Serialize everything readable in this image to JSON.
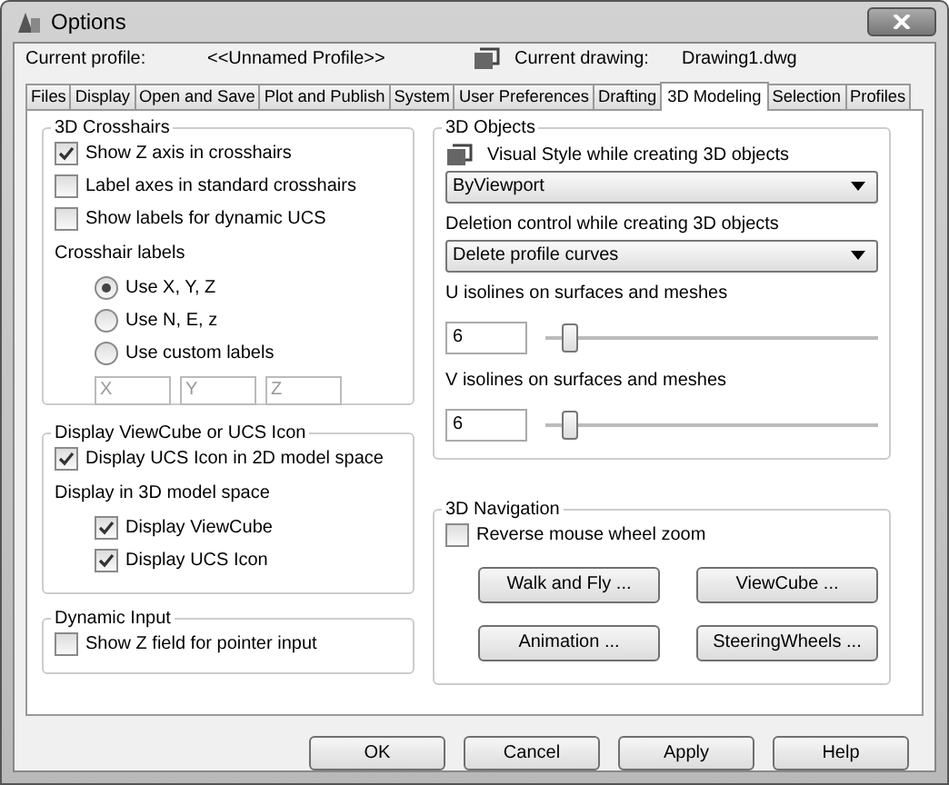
{
  "window": {
    "title": "Options"
  },
  "profile": {
    "label": "Current profile:",
    "value": "<<Unnamed Profile>>"
  },
  "drawing": {
    "label": "Current drawing:",
    "value": "Drawing1.dwg"
  },
  "tabs": [
    {
      "label": "Files",
      "selected": false
    },
    {
      "label": "Display",
      "selected": false
    },
    {
      "label": "Open and Save",
      "selected": false
    },
    {
      "label": "Plot and Publish",
      "selected": false
    },
    {
      "label": "System",
      "selected": false
    },
    {
      "label": "User Preferences",
      "selected": false
    },
    {
      "label": "Drafting",
      "selected": false
    },
    {
      "label": "3D Modeling",
      "selected": true
    },
    {
      "label": "Selection",
      "selected": false
    },
    {
      "label": "Profiles",
      "selected": false
    }
  ],
  "left_groups": [
    {
      "title": "3D Crosshairs",
      "items": [
        {
          "kind": "checkbox",
          "label": "Show Z axis in crosshairs",
          "checked": true
        },
        {
          "kind": "checkbox",
          "label": "Label axes in standard crosshairs",
          "checked": false
        },
        {
          "kind": "checkbox",
          "label": "Show labels for dynamic UCS",
          "checked": false
        },
        {
          "kind": "label",
          "label": "Crosshair labels",
          "children": [
            {
              "kind": "radio",
              "label": "Use X, Y, Z",
              "selected": true
            },
            {
              "kind": "radio",
              "label": "Use N, E, z",
              "selected": false
            },
            {
              "kind": "radio",
              "label": "Use custom labels",
              "selected": false
            },
            {
              "kind": "fields",
              "values": [
                "X",
                "Y",
                "Z"
              ]
            }
          ]
        }
      ]
    },
    {
      "title": "Display ViewCube or UCS Icon",
      "items": [
        {
          "kind": "checkbox",
          "label": "Display UCS Icon in 2D model space",
          "checked": true
        },
        {
          "kind": "label",
          "label": "Display in 3D model space",
          "children": [
            {
              "kind": "checkbox",
              "label": "Display ViewCube",
              "checked": true
            },
            {
              "kind": "checkbox",
              "label": "Display UCS Icon",
              "checked": true
            }
          ]
        }
      ]
    },
    {
      "title": "Dynamic Input",
      "items": [
        {
          "kind": "checkbox",
          "label": "Show Z field for pointer input",
          "checked": false
        }
      ]
    }
  ],
  "right_groups": [
    {
      "title": "3D Objects",
      "items": [
        {
          "kind": "icon-label",
          "label": "Visual Style while creating 3D objects"
        },
        {
          "kind": "dropdown",
          "value": "ByViewport"
        },
        {
          "kind": "label",
          "label": "Deletion control while creating 3D objects"
        },
        {
          "kind": "dropdown",
          "value": "Delete profile curves"
        },
        {
          "kind": "label",
          "label": "U isolines on surfaces and meshes"
        },
        {
          "kind": "slider",
          "value": "6",
          "level": 0.05
        },
        {
          "kind": "label",
          "label": "V isolines on surfaces and meshes"
        },
        {
          "kind": "slider",
          "value": "6",
          "level": 0.05
        }
      ]
    },
    {
      "title": "3D Navigation",
      "items": [
        {
          "kind": "checkbox",
          "label": "Reverse mouse wheel zoom",
          "checked": false
        },
        {
          "kind": "buttons",
          "labels": [
            "Walk and Fly ...",
            "ViewCube ...",
            "Animation ...",
            "SteeringWheels ..."
          ]
        }
      ]
    }
  ],
  "buttons": [
    "OK",
    "Cancel",
    "Apply",
    "Help"
  ]
}
